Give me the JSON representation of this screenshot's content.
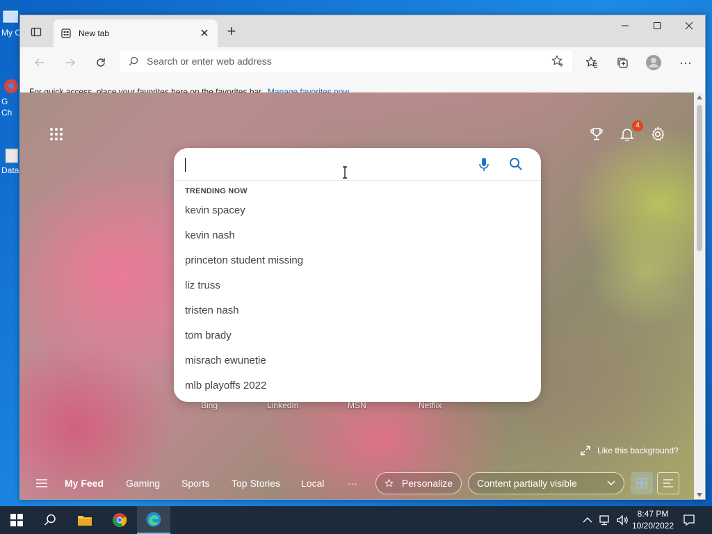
{
  "desktop": {
    "icons": [
      {
        "label": "My C"
      },
      {
        "label": "G\nCh"
      },
      {
        "label": "Data"
      }
    ]
  },
  "browser": {
    "tab": {
      "title": "New tab",
      "close": "✕"
    },
    "new_tab": "+",
    "window_controls": {
      "minimize": "—",
      "maximize": "☐",
      "close": "✕"
    },
    "address_bar": {
      "placeholder": "Search or enter web address"
    },
    "favorites_bar": {
      "message": "For quick access, place your favorites here on the favorites bar.",
      "link": "Manage favorites now"
    },
    "more": "···"
  },
  "newtab": {
    "notification_count": "4",
    "search": {
      "trending_heading": "TRENDING NOW",
      "suggestions": [
        "kevin spacey",
        "kevin nash",
        "princeton student missing",
        "liz truss",
        "tristen nash",
        "tom brady",
        "misrach ewunetie",
        "mlb playoffs 2022"
      ]
    },
    "shortcuts": [
      "Bing",
      "LinkedIn",
      "MSN",
      "Netflix"
    ],
    "like_background": "Like this background?",
    "feed": {
      "tabs": [
        "My Feed",
        "Gaming",
        "Sports",
        "Top Stories",
        "Local"
      ],
      "more": "···",
      "personalize": "Personalize",
      "content_visibility": "Content partially visible"
    }
  },
  "taskbar": {
    "time": "8:47 PM",
    "date": "10/20/2022"
  },
  "colors": {
    "accent": "#0f6cbd",
    "badge": "#d9481c",
    "taskbar": "#1c2a3a"
  }
}
